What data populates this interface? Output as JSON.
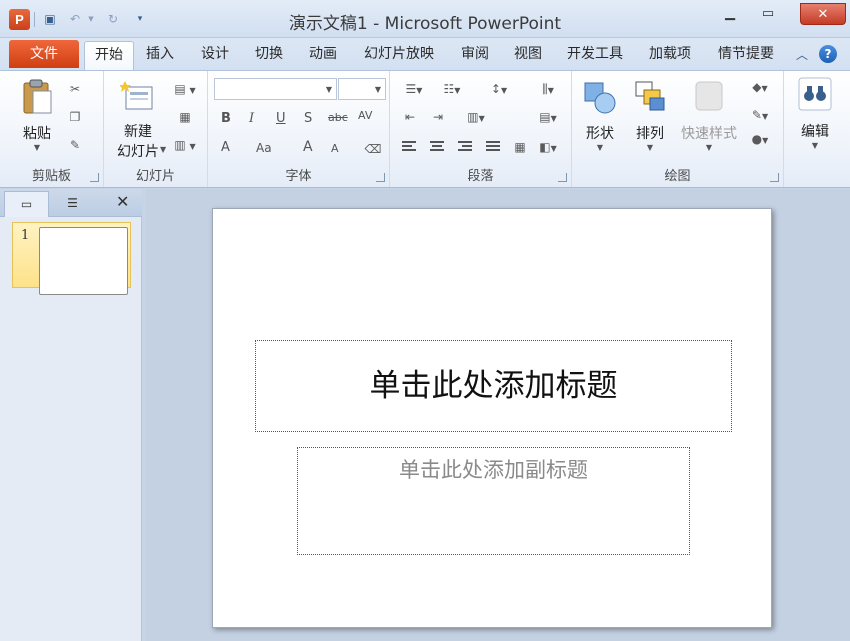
{
  "window": {
    "app_icon_letter": "P",
    "title": "演示文稿1 - Microsoft PowerPoint"
  },
  "tabs": {
    "file": "文件",
    "items": [
      "开始",
      "插入",
      "设计",
      "切换",
      "动画",
      "幻灯片放映",
      "审阅",
      "视图",
      "开发工具",
      "加载项",
      "情节提要"
    ]
  },
  "ribbon": {
    "clipboard": {
      "paste": "粘贴",
      "label": "剪贴板"
    },
    "slides": {
      "new_slide_line1": "新建",
      "new_slide_line2": "幻灯片",
      "label": "幻灯片"
    },
    "font": {
      "label": "字体",
      "bold": "B",
      "italic": "I",
      "underline": "U",
      "shadow": "S",
      "strike": "abc",
      "spacing": "AV",
      "case": "Aa",
      "grow": "A",
      "shrink": "A",
      "color": "A"
    },
    "paragraph": {
      "label": "段落"
    },
    "drawing": {
      "shapes": "形状",
      "arrange": "排列",
      "quick_styles": "快速样式",
      "label": "绘图"
    },
    "editing": {
      "label": "编辑"
    }
  },
  "pane": {
    "slide_number": "1"
  },
  "slide": {
    "title_placeholder": "单击此处添加标题",
    "subtitle_placeholder": "单击此处添加副标题"
  },
  "colors": {
    "file_tab": "#d8461b",
    "workspace": "#c4d1e3",
    "selected_thumb": "#fde28a"
  }
}
